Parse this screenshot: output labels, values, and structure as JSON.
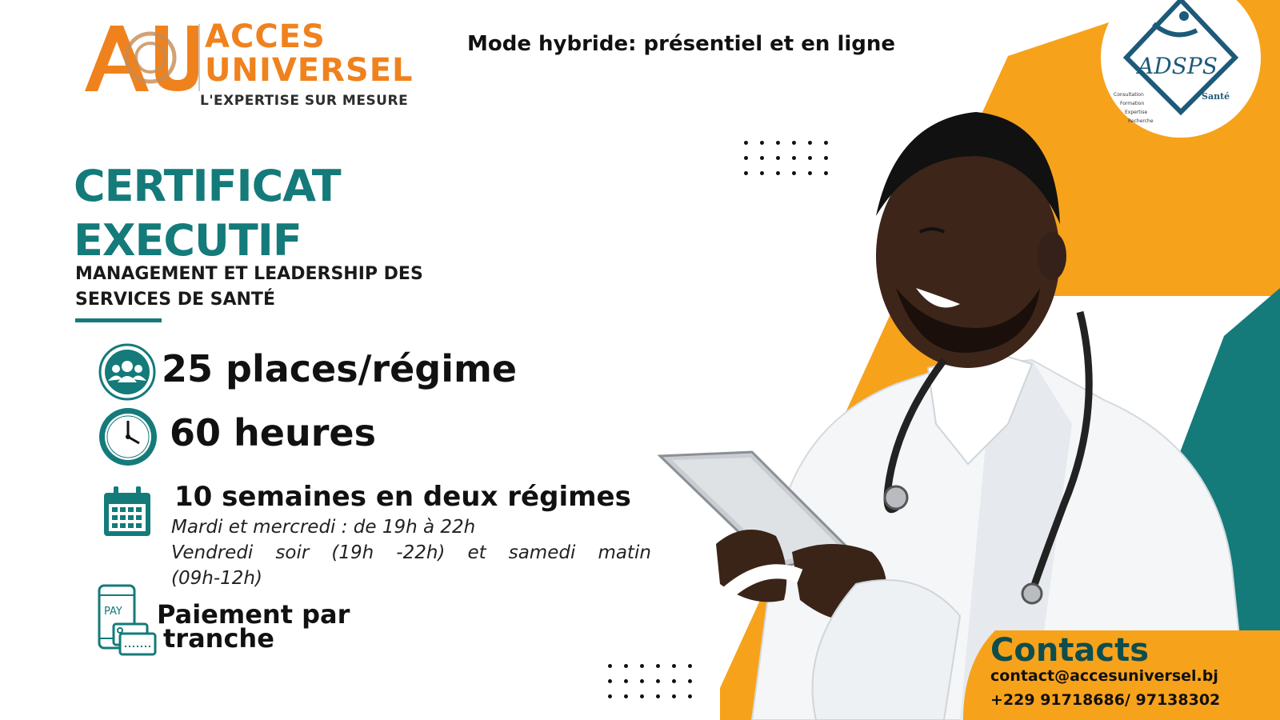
{
  "brand": {
    "logo_word_1": "ACCES",
    "logo_word_2": "UNIVERSEL",
    "logo_tagline": "L'EXPERTISE SUR MESURE",
    "partner_logo": "ADSPS",
    "partner_label": "Santé",
    "partner_items": [
      "Consultation",
      "Formation",
      "Expertise",
      "Recherche"
    ]
  },
  "mode": "Mode hybride: présentiel et en ligne",
  "title": {
    "line_1": "CERTIFICAT",
    "line_2": "EXECUTIF",
    "subtitle_1": "MANAGEMENT ET LEADERSHIP DES",
    "subtitle_2": "SERVICES DE SANTÉ"
  },
  "features": {
    "places": "25 places/régime",
    "hours": "60 heures",
    "weeks": "10 semaines en deux régimes",
    "schedule_1": "Mardi et mercredi : de 19h à 22h",
    "schedule_2_words": [
      "Vendredi",
      "soir",
      "(19h",
      "-22h)",
      "et",
      "samedi",
      "matin"
    ],
    "schedule_3": "(09h-12h)",
    "payment_1": "Paiement par",
    "payment_2": "tranche",
    "pay_icon_text": "PAY"
  },
  "contacts": {
    "title": "Contacts",
    "email": "contact@accesuniversel.bj",
    "phone": "+229 91718686/ 97138302"
  },
  "colors": {
    "teal": "#147a7a",
    "orange": "#f7a21b",
    "logo_orange": "#f0821e",
    "dark_teal_text": "#0e4d4d"
  },
  "icons": [
    "people-icon",
    "clock-icon",
    "calendar-icon",
    "pay-phone-icon"
  ]
}
